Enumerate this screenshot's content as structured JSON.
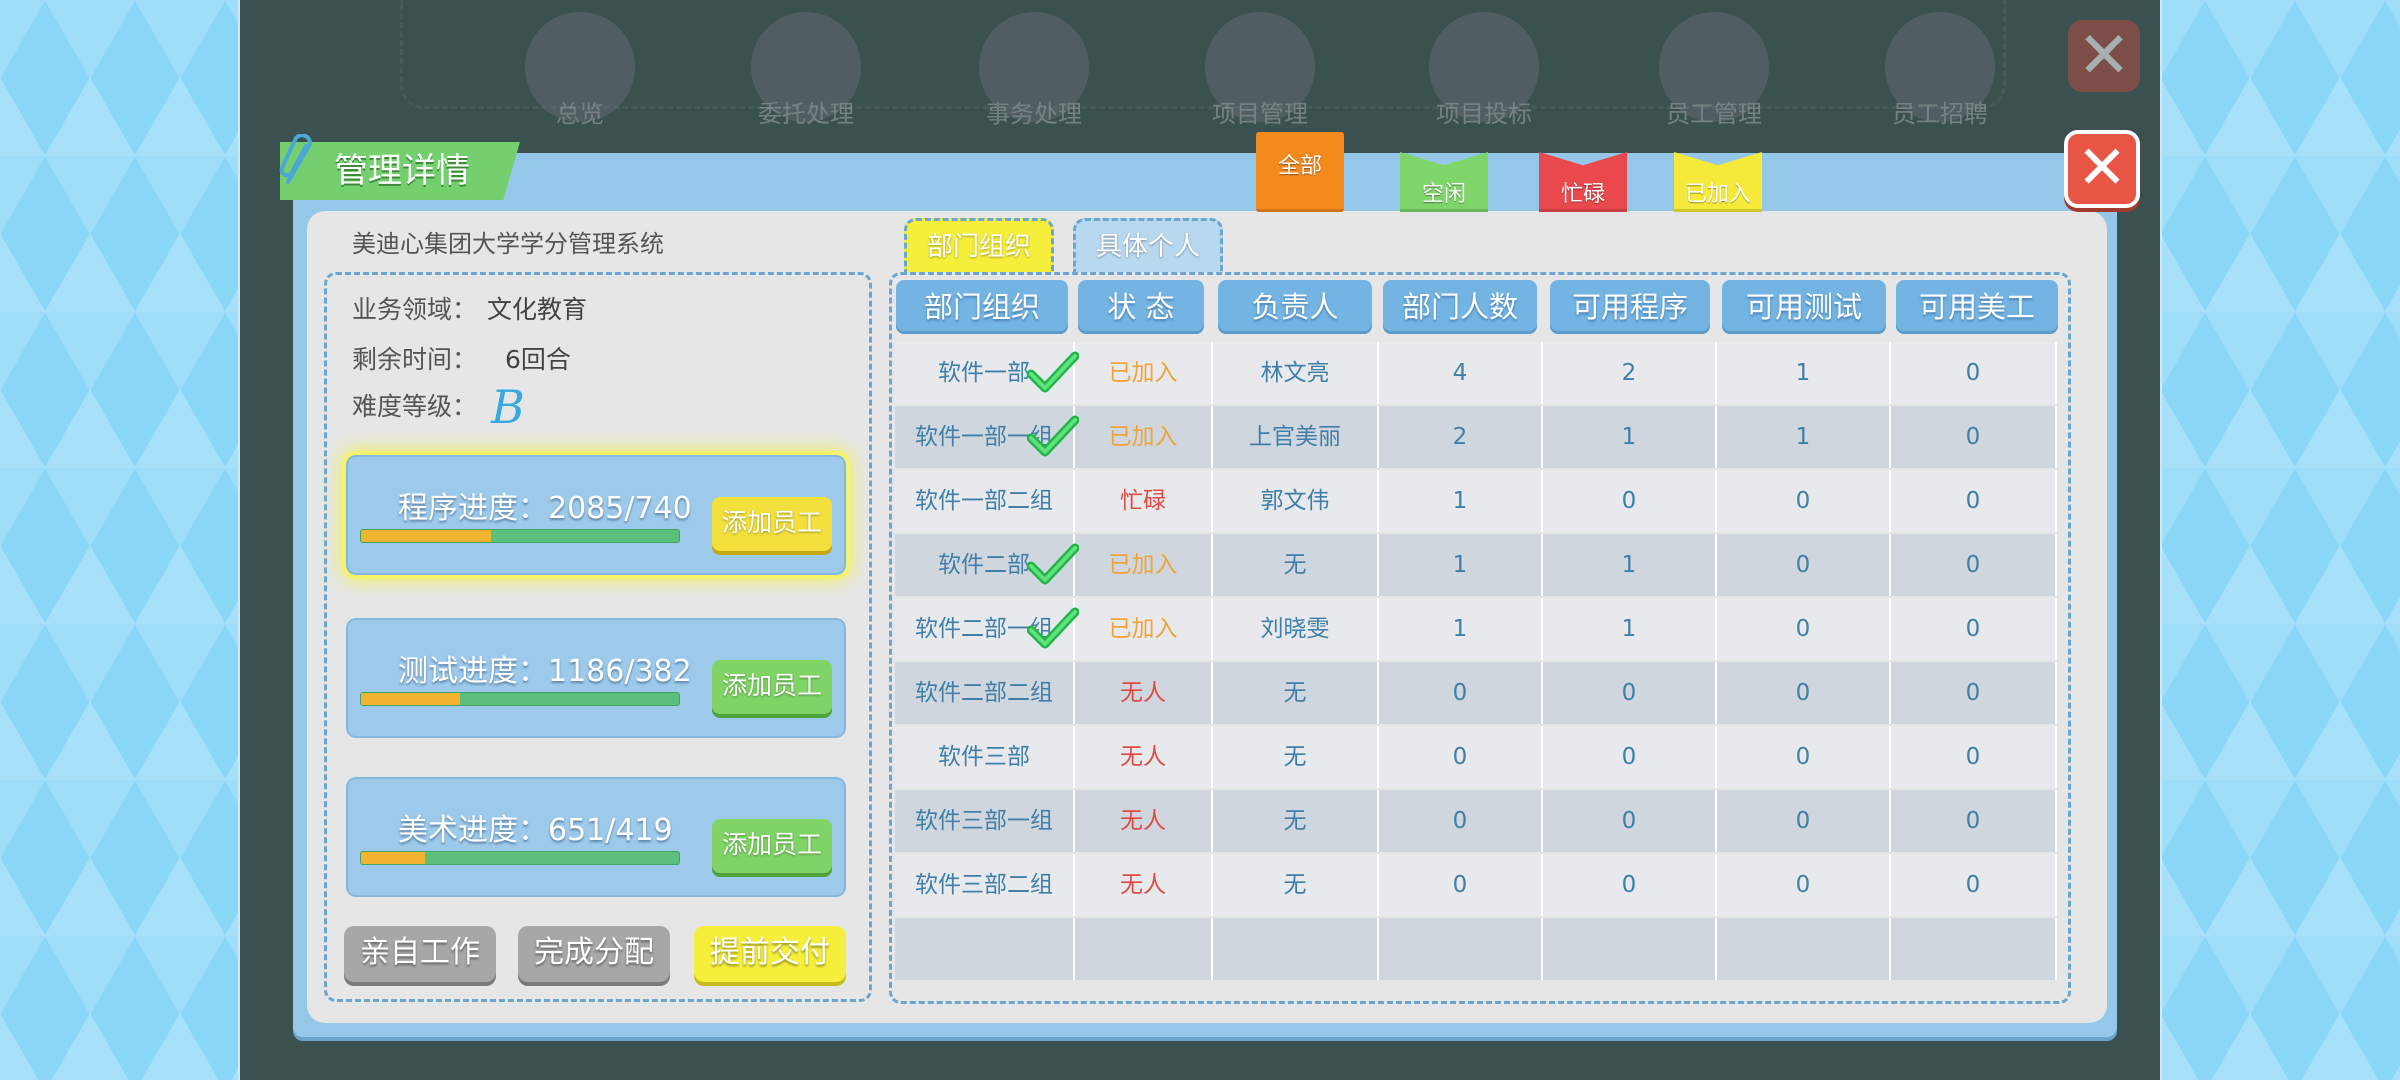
{
  "nav": {
    "items": [
      "总览",
      "委托处理",
      "事务处理",
      "项目管理",
      "项目投标",
      "员工管理",
      "员工招聘"
    ]
  },
  "panel": {
    "title": "管理详情",
    "project_name": "美迪心集团大学学分管理系统"
  },
  "filters": [
    {
      "label": "全部",
      "color": "#f48a1e"
    },
    {
      "label": "空闲",
      "color": "#7ed66a"
    },
    {
      "label": "忙碌",
      "color": "#e9494c"
    },
    {
      "label": "已加入",
      "color": "#f5ea3a"
    }
  ],
  "info": {
    "domain_label": "业务领域：",
    "domain_value": "文化教育",
    "time_label": "剩余时间：",
    "time_value": "6回合",
    "difficulty_label": "难度等级：",
    "difficulty_value": "B"
  },
  "progress": [
    {
      "label": "程序进度：2085/740",
      "fill": 0.41,
      "button": "添加员工"
    },
    {
      "label": "测试进度：1186/382",
      "fill": 0.31,
      "button": "添加员工"
    },
    {
      "label": "美术进度：651/419",
      "fill": 0.2,
      "button": "添加员工"
    }
  ],
  "buttons": {
    "work_self": "亲自工作",
    "finish_assign": "完成分配",
    "deliver_early": "提前交付"
  },
  "tabs": {
    "dept": "部门组织",
    "individual": "具体个人"
  },
  "table": {
    "headers": [
      "部门组织",
      "状  态",
      "负责人",
      "部门人数",
      "可用程序",
      "可用测试",
      "可用美工"
    ],
    "rows": [
      {
        "dept": "软件一部",
        "status": "已加入",
        "lead": "林文亮",
        "members": "4",
        "prog": "2",
        "test": "1",
        "art": "0",
        "checked": true
      },
      {
        "dept": "软件一部一组",
        "status": "已加入",
        "lead": "上官美丽",
        "members": "2",
        "prog": "1",
        "test": "1",
        "art": "0",
        "checked": true
      },
      {
        "dept": "软件一部二组",
        "status": "忙碌",
        "lead": "郭文伟",
        "members": "1",
        "prog": "0",
        "test": "0",
        "art": "0",
        "checked": false
      },
      {
        "dept": "软件二部",
        "status": "已加入",
        "lead": "无",
        "members": "1",
        "prog": "1",
        "test": "0",
        "art": "0",
        "checked": true
      },
      {
        "dept": "软件二部一组",
        "status": "已加入",
        "lead": "刘晓雯",
        "members": "1",
        "prog": "1",
        "test": "0",
        "art": "0",
        "checked": true
      },
      {
        "dept": "软件二部二组",
        "status": "无人",
        "lead": "无",
        "members": "0",
        "prog": "0",
        "test": "0",
        "art": "0",
        "checked": false
      },
      {
        "dept": "软件三部",
        "status": "无人",
        "lead": "无",
        "members": "0",
        "prog": "0",
        "test": "0",
        "art": "0",
        "checked": false
      },
      {
        "dept": "软件三部一组",
        "status": "无人",
        "lead": "无",
        "members": "0",
        "prog": "0",
        "test": "0",
        "art": "0",
        "checked": false
      },
      {
        "dept": "软件三部二组",
        "status": "无人",
        "lead": "无",
        "members": "0",
        "prog": "0",
        "test": "0",
        "art": "0",
        "checked": false
      }
    ]
  },
  "icons": {
    "close": "close-icon",
    "check": "check-icon",
    "paperclip": "paperclip-icon"
  },
  "colors": {
    "joined": "#f0a338",
    "busy": "#e04a44",
    "cell_text": "#3f7fa8",
    "header_bg": "#73b4e3"
  }
}
